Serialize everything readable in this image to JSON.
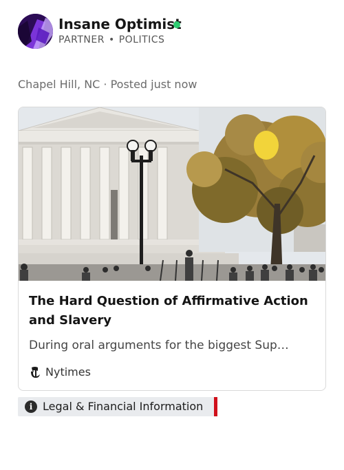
{
  "author": {
    "name": "Insane Optimist",
    "role": "PARTNER",
    "separator": "•",
    "category": "POLITICS",
    "online": true,
    "online_color": "#2ecc71"
  },
  "post": {
    "location": "Chapel Hill, NC · Posted just now"
  },
  "card": {
    "title": "The Hard Question of Affirmative Action and Slavery",
    "description": "During oral arguments for the biggest Sup…",
    "source": "Nytimes",
    "source_icon": "nytimes-logo-icon"
  },
  "legal": {
    "label": "Legal & Financial Information",
    "icon": "info-icon",
    "info_glyph": "i",
    "accent": "#d0101b"
  }
}
